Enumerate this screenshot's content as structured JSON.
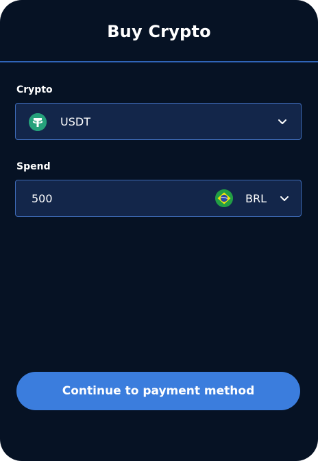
{
  "header": {
    "title": "Buy Crypto"
  },
  "crypto": {
    "label": "Crypto",
    "selected": "USDT",
    "icon": "tether-icon",
    "icon_color": "#26a17b"
  },
  "spend": {
    "label": "Spend",
    "amount": "500",
    "currency": "BRL",
    "flag_icon": "brazil-flag-icon"
  },
  "cta": {
    "label": "Continue to payment method"
  },
  "colors": {
    "background": "#061224",
    "field_bg": "#13264a",
    "field_border": "#3e6bb8",
    "accent": "#3b7ddd",
    "header_divider": "#2f64b8"
  }
}
